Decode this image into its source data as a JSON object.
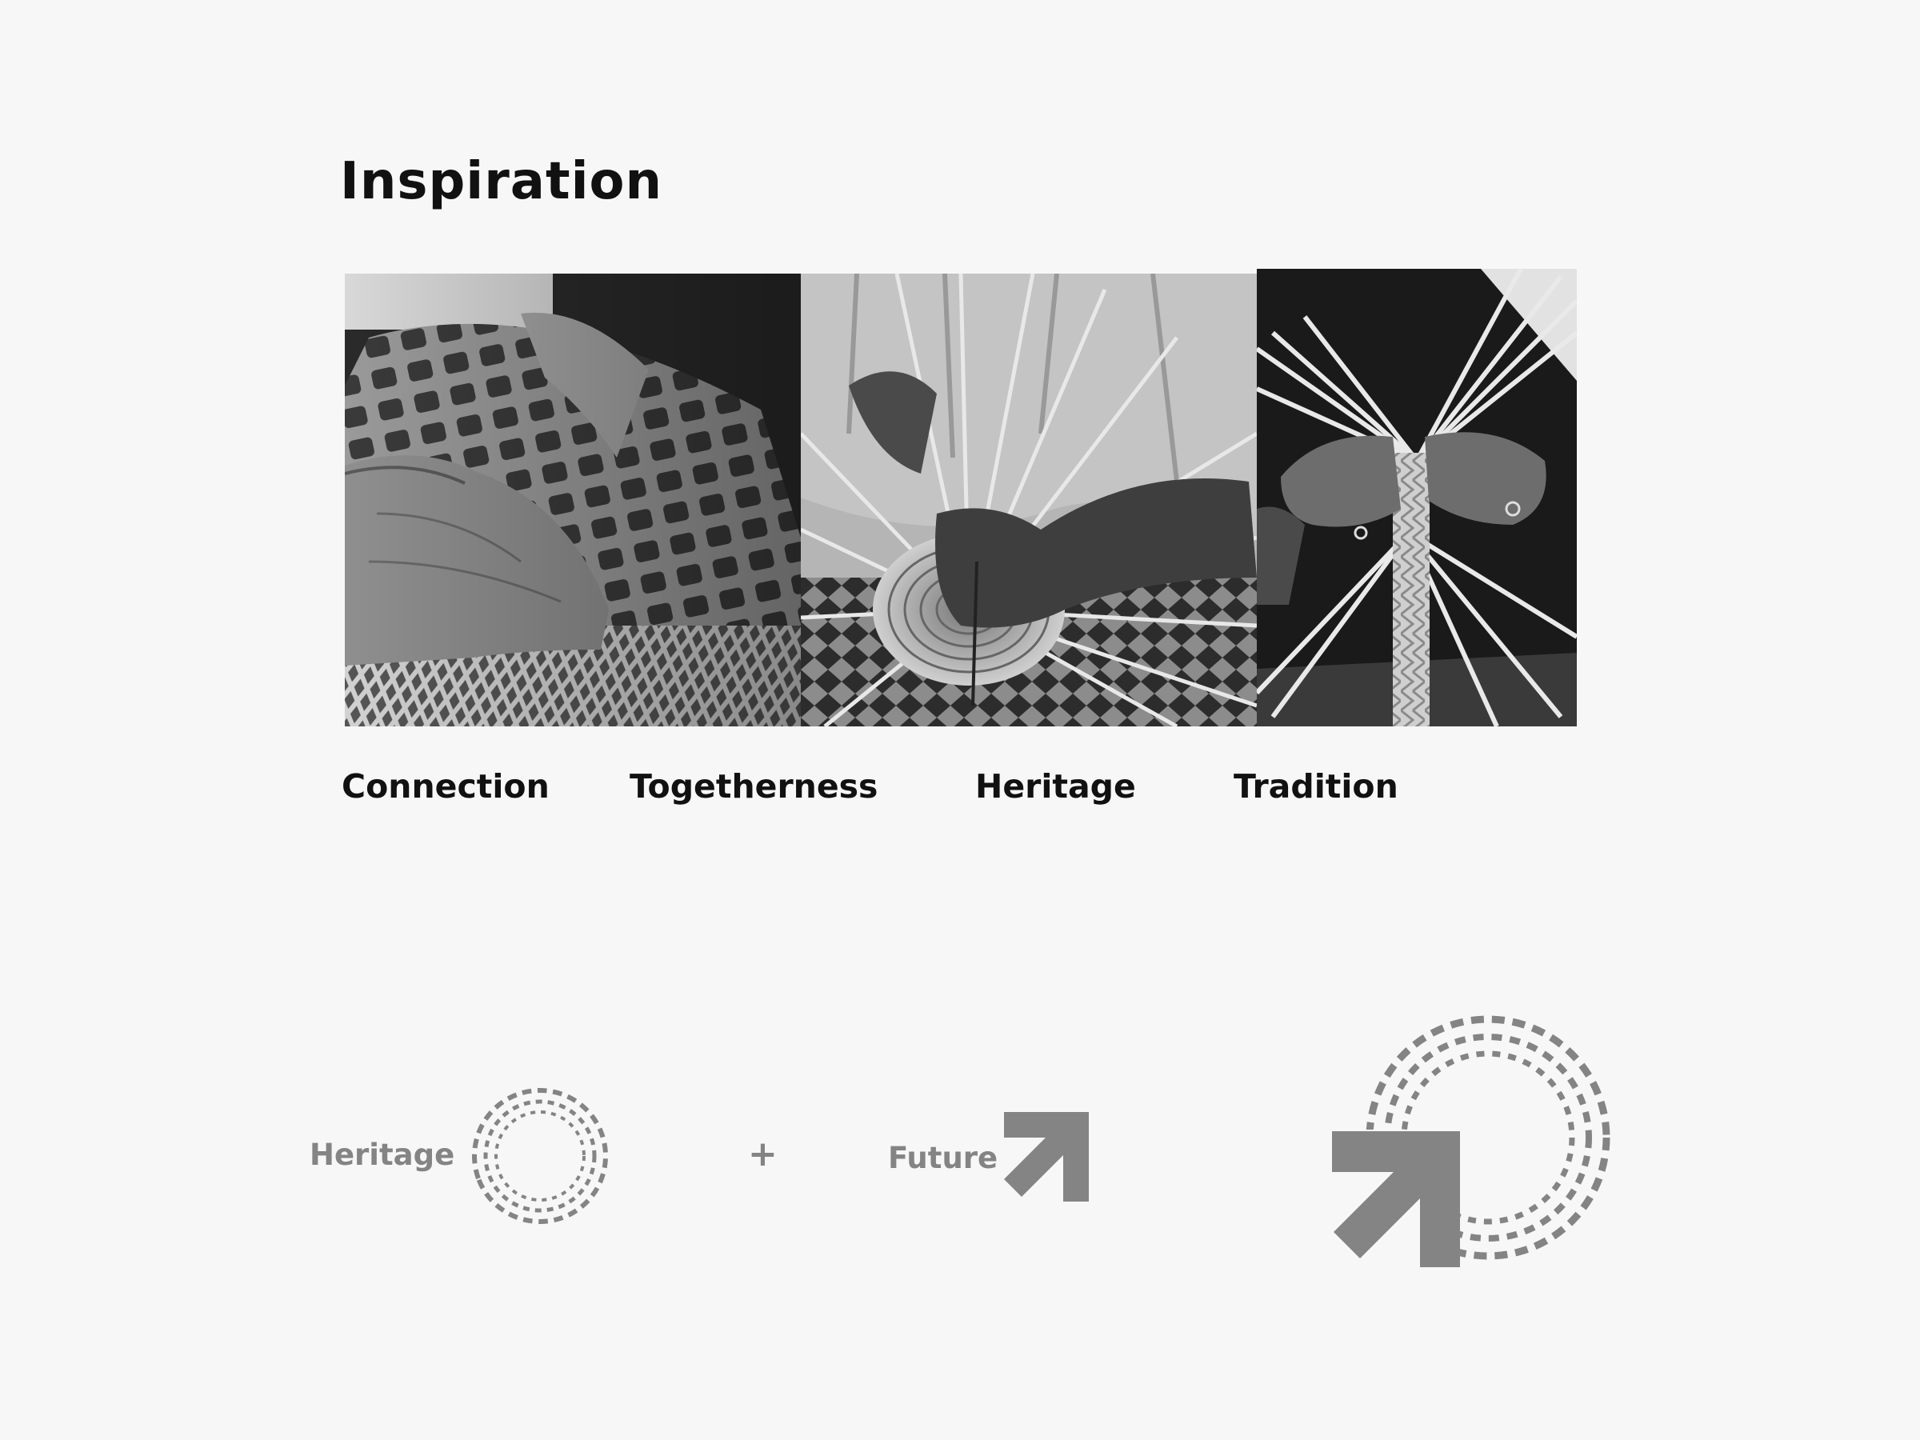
{
  "page": {
    "title": "Inspiration"
  },
  "photos": [
    {
      "icon": "basket-weaving-hands-photo"
    },
    {
      "icon": "circular-basket-weaving-photo"
    },
    {
      "icon": "palm-leaf-braiding-photo"
    }
  ],
  "captions": [
    "Connection",
    "Togetherness",
    "Heritage",
    "Tradition"
  ],
  "equation": {
    "left_label": "Heritage",
    "operator": "+",
    "right_label": "Future"
  },
  "colors": {
    "background": "#f7f7f7",
    "text": "#111111",
    "mark_gray": "#848484"
  }
}
